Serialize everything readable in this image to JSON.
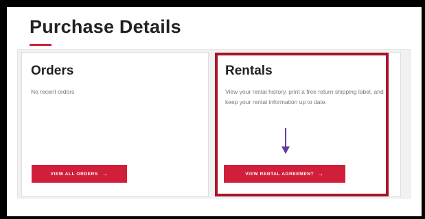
{
  "page": {
    "title": "Purchase Details"
  },
  "orders": {
    "title": "Orders",
    "description": "No recent orders",
    "button_label": "VIEW ALL ORDERS",
    "button_icon": "arrow-right-icon"
  },
  "rentals": {
    "title": "Rentals",
    "description": "View your rental history, print a free return shipping label, and keep your rental information up to date.",
    "button_label": "VIEW RENTAL AGREEMENT",
    "button_icon": "arrow-right-icon"
  },
  "colors": {
    "accent": "#d11f3b",
    "highlight_border": "#a8142a",
    "pointer_arrow": "#6a3aa3"
  }
}
